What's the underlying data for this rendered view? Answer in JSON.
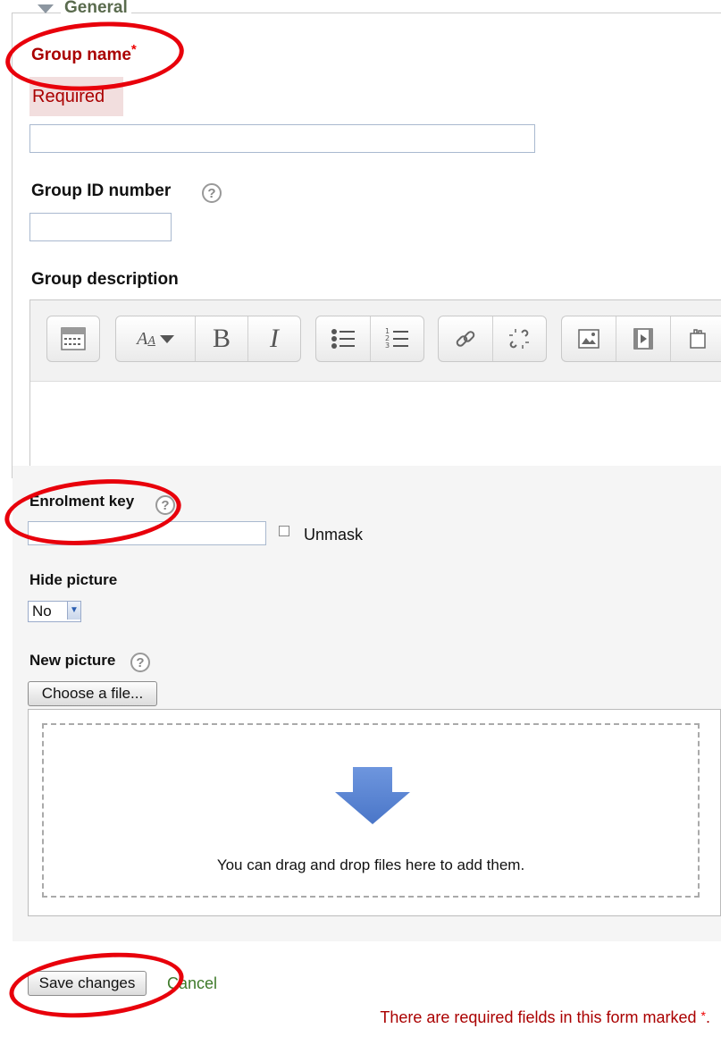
{
  "section": {
    "legend": "General"
  },
  "group_name": {
    "label": "Group name",
    "required_marker": "*",
    "error": "Required",
    "value": ""
  },
  "group_id": {
    "label": "Group ID number",
    "value": "",
    "help_icon": "question-help-icon"
  },
  "group_description": {
    "label": "Group description",
    "toolbar": [
      {
        "name": "toolbar-toggle-button",
        "icon": "show-more-icon"
      },
      {
        "name": "font-style-button",
        "icon": "font-size-icon",
        "glyph": "A̲A"
      },
      {
        "name": "bold-button",
        "icon": "bold-icon",
        "glyph": "B"
      },
      {
        "name": "italic-button",
        "icon": "italic-icon",
        "glyph": "I"
      },
      {
        "name": "unordered-list-button",
        "icon": "bullet-list-icon"
      },
      {
        "name": "ordered-list-button",
        "icon": "numbered-list-icon"
      },
      {
        "name": "link-button",
        "icon": "link-icon"
      },
      {
        "name": "unlink-button",
        "icon": "unlink-icon"
      },
      {
        "name": "image-button",
        "icon": "image-icon"
      },
      {
        "name": "media-button",
        "icon": "media-icon"
      },
      {
        "name": "manage-files-button",
        "icon": "files-icon"
      }
    ]
  },
  "enrolment_key": {
    "label": "Enrolment key",
    "value": "",
    "unmask_label": "Unmask"
  },
  "hide_picture": {
    "label": "Hide picture",
    "selected": "No"
  },
  "new_picture": {
    "label": "New picture",
    "choose_button": "Choose a file...",
    "drop_text": "You can drag and drop files here to add them."
  },
  "actions": {
    "save": "Save changes",
    "cancel": "Cancel"
  },
  "footer_note": {
    "text": "There are required fields in this form marked ",
    "marker": "*",
    "end": "."
  },
  "colors": {
    "required": "#aa0000",
    "annotation_circle": "#e8000b",
    "drop_arrow": "#5b86d6",
    "cancel_link": "#3e7a2a"
  }
}
